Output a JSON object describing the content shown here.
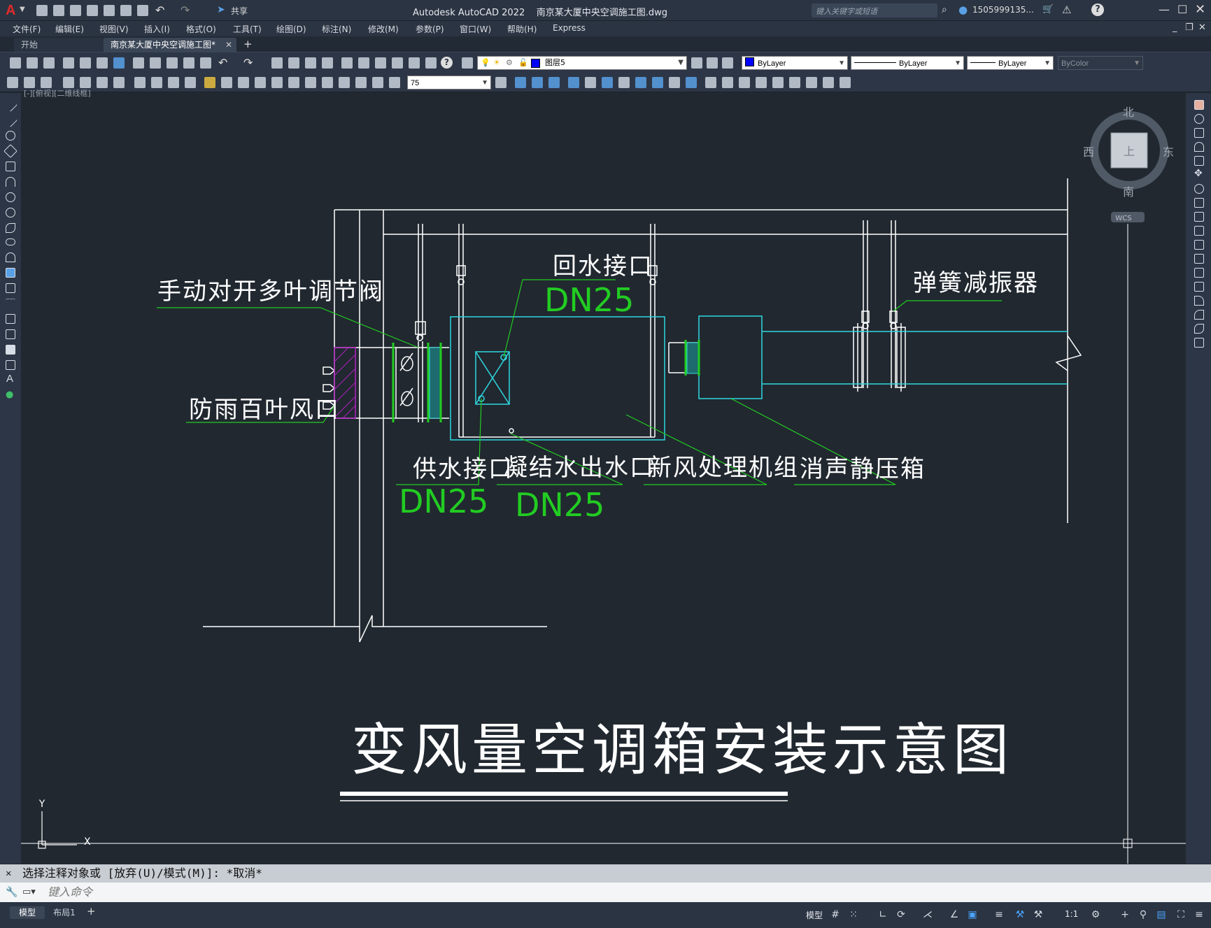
{
  "app": {
    "title": "Autodesk AutoCAD 2022    南京某大厦中央空调施工图.dwg",
    "search_placeholder": "键入关键字或短语",
    "user": "1505999135...",
    "share": "共享"
  },
  "menu": [
    "文件(F)",
    "编辑(E)",
    "视图(V)",
    "插入(I)",
    "格式(O)",
    "工具(T)",
    "绘图(D)",
    "标注(N)",
    "修改(M)",
    "参数(P)",
    "窗口(W)",
    "帮助(H)",
    "Express"
  ],
  "tabs": {
    "start": "开始",
    "document": "南京某大厦中央空调施工图*",
    "add": "+"
  },
  "toolbar": {
    "layer": "图层5",
    "color": "ByLayer",
    "linetype": "ByLayer",
    "lineweight": "ByLayer",
    "plotstyle": "ByColor",
    "dimscale": "75",
    "color_swatch": "#0000ff"
  },
  "viewport": {
    "label": "[-][俯视][二维线框]"
  },
  "viewcube": {
    "north": "北",
    "south": "南",
    "east": "东",
    "west": "西",
    "top": "上",
    "wcs": "WCS"
  },
  "ucs": {
    "x": "X",
    "y": "Y"
  },
  "drawing": {
    "labels": {
      "damper": "手动对开多叶调节阀",
      "louver": "防雨百叶风口",
      "return": "回水接口",
      "return_dn": "DN25",
      "spring": "弹簧减振器",
      "supply": "供水接口",
      "supply_dn": "DN25",
      "condensate": "凝结水出水口",
      "condensate_dn": "DN25",
      "ahu": "新风处理机组",
      "silencer": "消声静压箱"
    },
    "title": "变风量空调箱安装示意图"
  },
  "command": {
    "history": "选择注释对象或 [放弃(U)/模式(M)]: *取消*",
    "placeholder": "键入命令"
  },
  "status": {
    "model_tab": "模型",
    "layout_tab": "布局1",
    "add": "+",
    "model": "模型",
    "scale": "1:1"
  }
}
